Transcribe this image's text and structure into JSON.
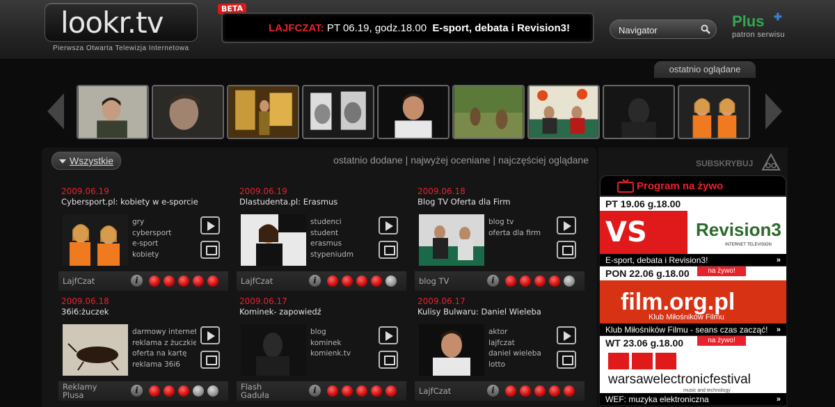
{
  "header": {
    "logo_text": "lookr.tv",
    "beta_badge": "BETA",
    "tagline": "Pierwsza Otwarta Telewizja Internetowa",
    "ticker": {
      "label": "LAJFCZAT:",
      "date": "PT 06.19, godz.18.00",
      "title": "E-sport, debata i Revision3!"
    },
    "search": {
      "placeholder": "Navigator"
    },
    "sponsor": {
      "name": "Plus",
      "subtitle": "patron serwisu"
    }
  },
  "carousel": {
    "tab_label": "ostatnio oglądane",
    "thumbnails": [
      "thumb-1",
      "thumb-2",
      "thumb-3",
      "thumb-4",
      "thumb-5",
      "thumb-6",
      "thumb-7",
      "thumb-8",
      "thumb-9"
    ]
  },
  "list": {
    "filter_label": "Wszystkie",
    "sort": {
      "recent": "ostatnio dodane",
      "top_rated": "najwyżej oceniane",
      "most_watched": "najczęściej oglądane",
      "separator": "|"
    },
    "items": [
      {
        "date": "2009.06.19",
        "title": "Cybersport.pl: kobiety w e-sporcie",
        "tags": [
          "gry",
          "cybersport",
          "e-sport",
          "kobiety"
        ],
        "channel": "LajfCzat",
        "rating": 5
      },
      {
        "date": "2009.06.19",
        "title": "Dlastudenta.pl: Erasmus",
        "tags": [
          "studenci",
          "student",
          "erasmus",
          "stypeniudm"
        ],
        "channel": "LajfCzat",
        "rating": 4
      },
      {
        "date": "2009.06.18",
        "title": "Blog  TV Oferta dla Firm",
        "tags": [
          "blog tv",
          "oferta dla firm"
        ],
        "channel": "blog TV",
        "rating": 4
      },
      {
        "date": "2009.06.18",
        "title": "36i6:żuczek",
        "tags": [
          "darmowy internet",
          "reklama z żuczkiem",
          "oferta na kartę",
          "reklama 36i6"
        ],
        "channel": "Reklamy Plusa",
        "rating": 3
      },
      {
        "date": "2009.06.17",
        "title": "Kominek- zapowiedź",
        "tags": [
          "blog",
          "kominek",
          "komienk.tv"
        ],
        "channel": "Flash Gaduła",
        "rating": 5
      },
      {
        "date": "2009.06.17",
        "title": "Kulisy Bulwaru: Daniel Wieleba",
        "tags": [
          "aktor",
          "lajfczat",
          "daniel wieleba",
          "lotto"
        ],
        "channel": "LajfCzat",
        "rating": 5
      }
    ]
  },
  "right": {
    "subscribe": "SUBSKRYBUJ",
    "live_title": "Program na żywo",
    "live_items": [
      {
        "when": "PT  19.06 g.18.00",
        "badge": "",
        "banner_text": "Revision3",
        "banner_sub": "INTERNET TELEVISION",
        "caption": "E-sport, debata i Revision3!",
        "more": "»"
      },
      {
        "when": "PON  22.06 g.18.00",
        "badge": "na żywo!",
        "banner_text": "film.org.pl",
        "banner_sub": "Klub Miłośników Filmu",
        "caption": "Klub Miłośników Filmu - seans czas zacząć!",
        "more": "»"
      },
      {
        "when": "WT  23.06 g.18.00",
        "badge": "na żywo!",
        "banner_text": "warsawelectronicfestival",
        "banner_sub": "music and technology",
        "caption": "WEF: muzyka elektroniczna",
        "more": "»"
      }
    ]
  }
}
